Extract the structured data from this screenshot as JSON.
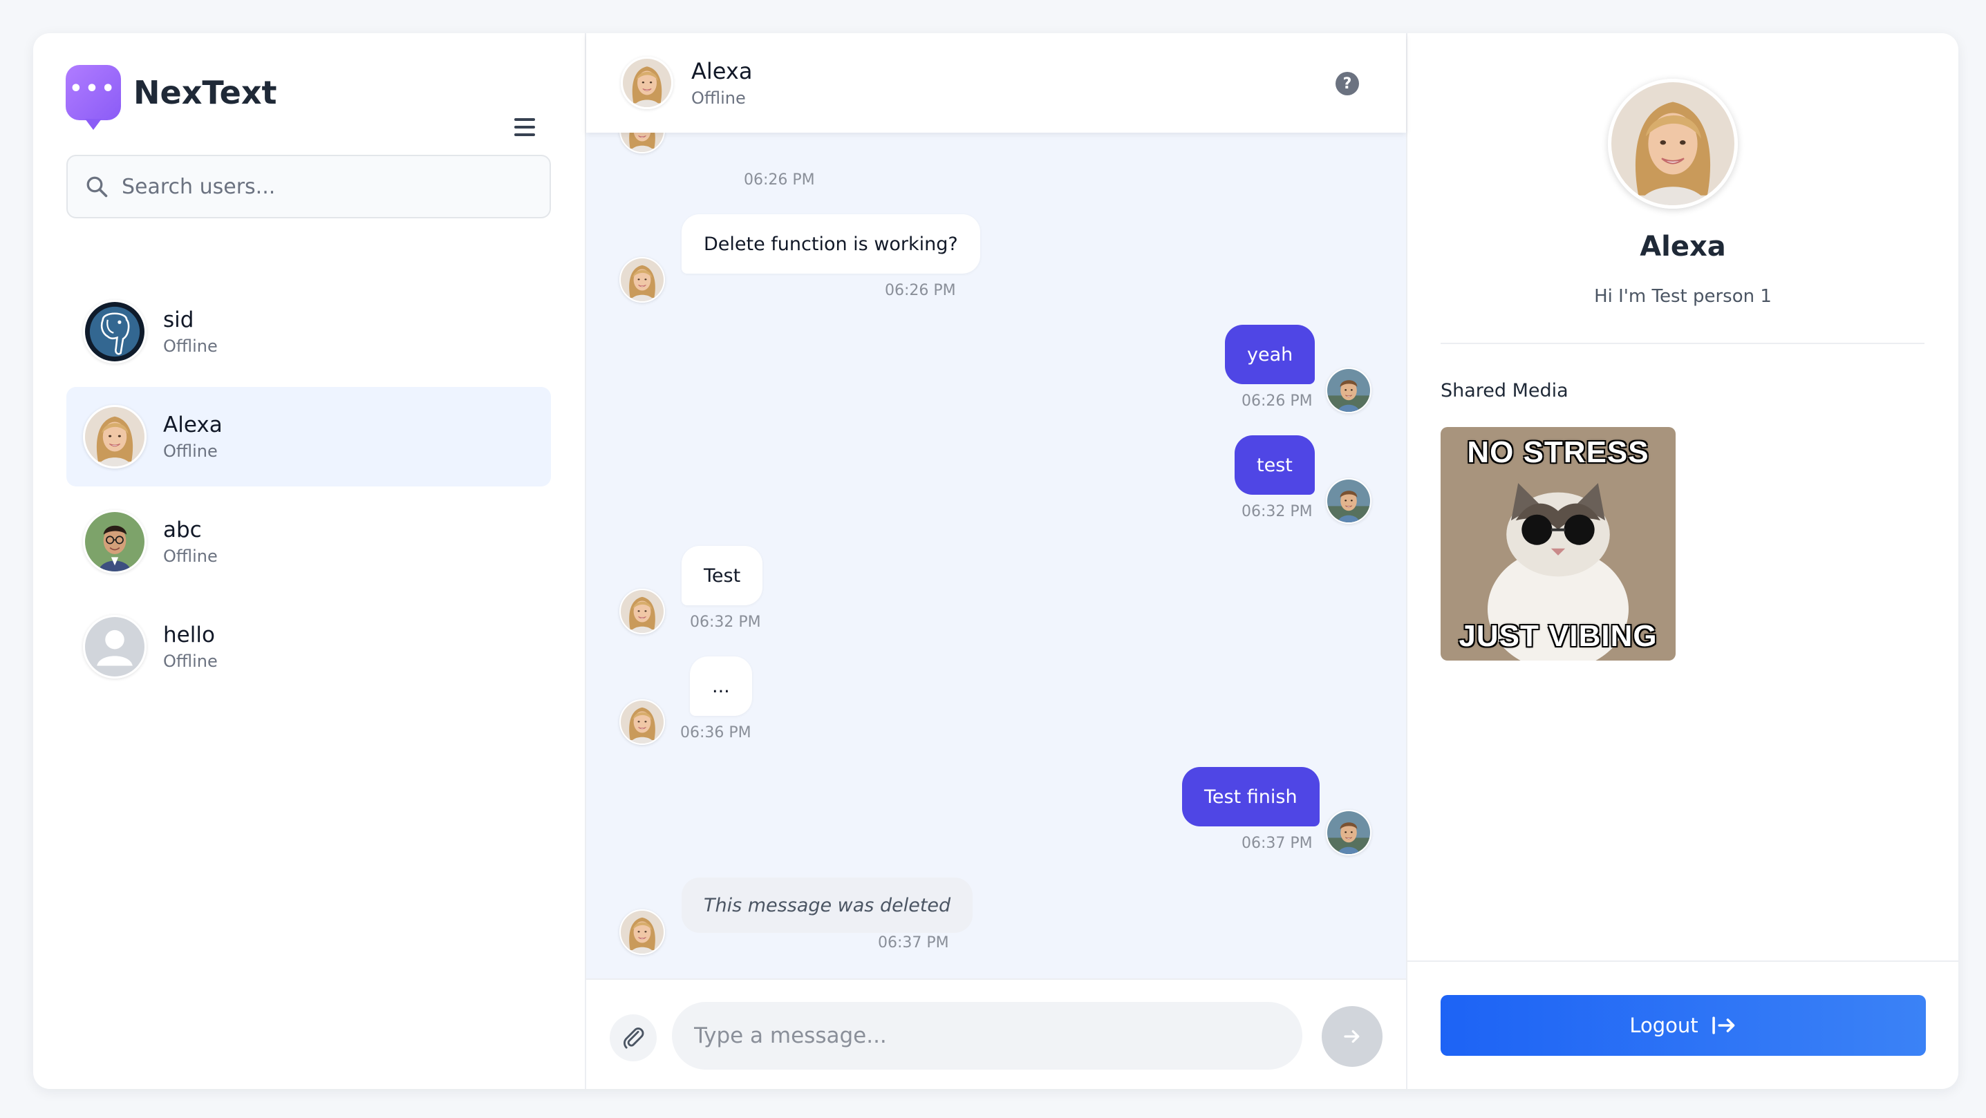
{
  "app": {
    "name": "NexText",
    "logo_icon": "chat-bubble-dots-icon",
    "accent": "#8b5cf6"
  },
  "sidebar": {
    "search_placeholder": "Search users...",
    "users": [
      {
        "name": "sid",
        "status": "Offline",
        "avatar": "elephant-logo"
      },
      {
        "name": "Alexa",
        "status": "Offline",
        "avatar": "photo-woman",
        "active": true
      },
      {
        "name": "abc",
        "status": "Offline",
        "avatar": "photo-man-glasses"
      },
      {
        "name": "hello",
        "status": "Offline",
        "avatar": "default-user-icon"
      }
    ]
  },
  "chat": {
    "header": {
      "name": "Alexa",
      "status": "Offline"
    },
    "messages": [
      {
        "from": "them",
        "text": "",
        "time": "06:26 PM"
      },
      {
        "from": "them",
        "text": "Delete function is working?",
        "time": "06:26 PM"
      },
      {
        "from": "me",
        "text": "yeah",
        "time": "06:26 PM"
      },
      {
        "from": "me",
        "text": "test",
        "time": "06:32 PM"
      },
      {
        "from": "them",
        "text": "Test",
        "time": "06:32 PM"
      },
      {
        "from": "them",
        "text": "...",
        "time": "06:36 PM"
      },
      {
        "from": "me",
        "text": "Test finish",
        "time": "06:37 PM"
      },
      {
        "from": "them",
        "text": "This message was deleted",
        "time": "06:37 PM",
        "deleted": true
      }
    ],
    "composer": {
      "placeholder": "Type a message..."
    },
    "out_bubble_color": "#4f46e5"
  },
  "profile": {
    "name": "Alexa",
    "bio": "Hi I'm Test person 1",
    "shared_media_title": "Shared Media",
    "media": [
      {
        "top_text": "NO STRESS",
        "bottom_text": "JUST VIBING"
      }
    ],
    "logout_label": "Logout",
    "logout_color": "#1d63f5"
  }
}
